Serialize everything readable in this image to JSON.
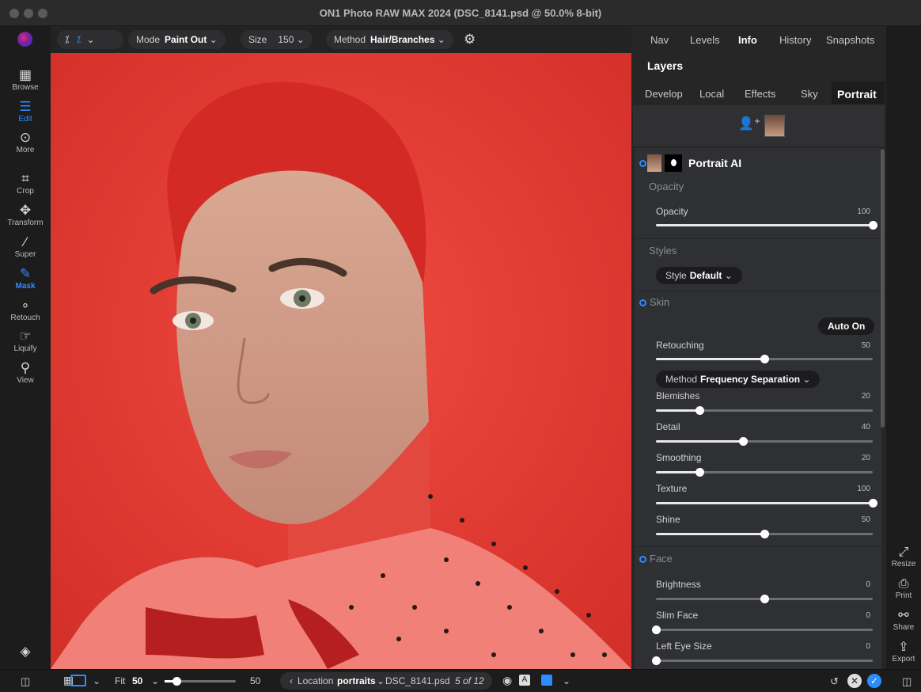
{
  "window": {
    "title": "ON1 Photo RAW MAX 2024 (DSC_8141.psd @ 50.0% 8-bit)"
  },
  "left_tools": [
    {
      "label": "Browse",
      "icon": "browse-grid-icon"
    },
    {
      "label": "Edit",
      "icon": "sliders-icon",
      "active": true
    },
    {
      "label": "More",
      "icon": "more-dots-icon"
    },
    {
      "label": "Crop",
      "icon": "crop-icon"
    },
    {
      "label": "Transform",
      "icon": "transform-arrows-icon"
    },
    {
      "label": "Super",
      "icon": "magic-wand-icon"
    },
    {
      "label": "Mask",
      "icon": "mask-brush-icon",
      "active": true
    },
    {
      "label": "Retouch",
      "icon": "retouch-icon"
    },
    {
      "label": "Liquify",
      "icon": "liquify-icon"
    },
    {
      "label": "View",
      "icon": "zoom-hand-icon"
    }
  ],
  "toolbar": {
    "mode_label": "Mode",
    "mode_value": "Paint Out",
    "size_label": "Size",
    "size_value": "150",
    "method_label": "Method",
    "method_value": "Hair/Branches"
  },
  "panel_tabs": [
    "Nav",
    "Levels",
    "Info",
    "History",
    "Snapshots"
  ],
  "panel_tab_active": "Info",
  "layers_title": "Layers",
  "module_tabs": [
    "Develop",
    "Local",
    "Effects",
    "Sky",
    "Portrait"
  ],
  "module_tab_active": "Portrait",
  "portrait": {
    "name": "Portrait AI",
    "opacity_section": "Opacity",
    "opacity": {
      "label": "Opacity",
      "value": "100",
      "level": 1.0
    },
    "styles_section": "Styles",
    "style_label": "Style",
    "style_value": "Default",
    "skin_section": "Skin",
    "auto_button": "Auto On",
    "retouching": {
      "label": "Retouching",
      "value": "50",
      "level": 0.5
    },
    "method_label": "Method",
    "method_value": "Frequency Separation",
    "skin_sliders": [
      {
        "label": "Blemishes",
        "value": "20",
        "level": 0.2
      },
      {
        "label": "Detail",
        "value": "40",
        "level": 0.4
      },
      {
        "label": "Smoothing",
        "value": "20",
        "level": 0.2
      },
      {
        "label": "Texture",
        "value": "100",
        "level": 1.0
      },
      {
        "label": "Shine",
        "value": "50",
        "level": 0.5
      }
    ],
    "face_section": "Face",
    "face_sliders": [
      {
        "label": "Brightness",
        "value": "0",
        "level": 0.5
      },
      {
        "label": "Slim Face",
        "value": "0",
        "level": 0.0
      },
      {
        "label": "Left Eye Size",
        "value": "0",
        "level": 0.0
      }
    ]
  },
  "right_tools": [
    {
      "label": "Resize",
      "icon": "resize-icon"
    },
    {
      "label": "Print",
      "icon": "printer-icon"
    },
    {
      "label": "Share",
      "icon": "share-icon"
    },
    {
      "label": "Export",
      "icon": "export-icon"
    }
  ],
  "bottom": {
    "fit_label": "Fit",
    "fit_value": "50",
    "zoom_value": "50",
    "location_label": "Location",
    "location_value": "portraits",
    "filename": "DSC_8141.psd",
    "count": "5 of 12"
  },
  "colors": {
    "accent": "#2d8cff",
    "mask_overlay": "#e23a32"
  }
}
